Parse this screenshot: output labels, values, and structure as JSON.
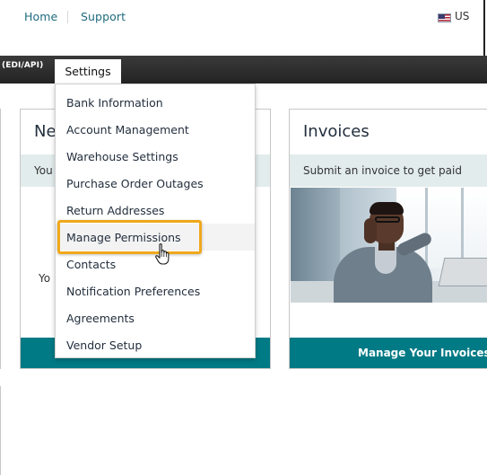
{
  "top_links": {
    "home": "Home",
    "support": "Support",
    "locale": "US",
    "locale_icon": "us-flag-icon"
  },
  "navbar": {
    "partial_tab": "(EDI/API)",
    "active_tab": "Settings"
  },
  "settings_menu": {
    "items": [
      "Bank Information",
      "Account Management",
      "Warehouse Settings",
      "Purchase Order Outages",
      "Return Addresses",
      "Manage Permissions",
      "Contacts",
      "Notification Preferences",
      "Agreements",
      "Vendor Setup"
    ],
    "highlighted_item": "Manage Permissions",
    "highlight_color": "#f0a81c"
  },
  "cards": {
    "news": {
      "title_partial": "Ne",
      "band_text_partial": "You",
      "body_text_partial": "Yo"
    },
    "invoices": {
      "title": "Invoices",
      "band_text": "Submit an invoice to get paid",
      "image": "man-on-phone-photo",
      "footer_button": "Manage Your Invoices"
    }
  },
  "colors": {
    "link": "#1f6b7e",
    "navbar": "#232323",
    "footer_teal": "#007a85",
    "band": "#e3ecec"
  },
  "cursor_icon": "hand-pointer-icon"
}
